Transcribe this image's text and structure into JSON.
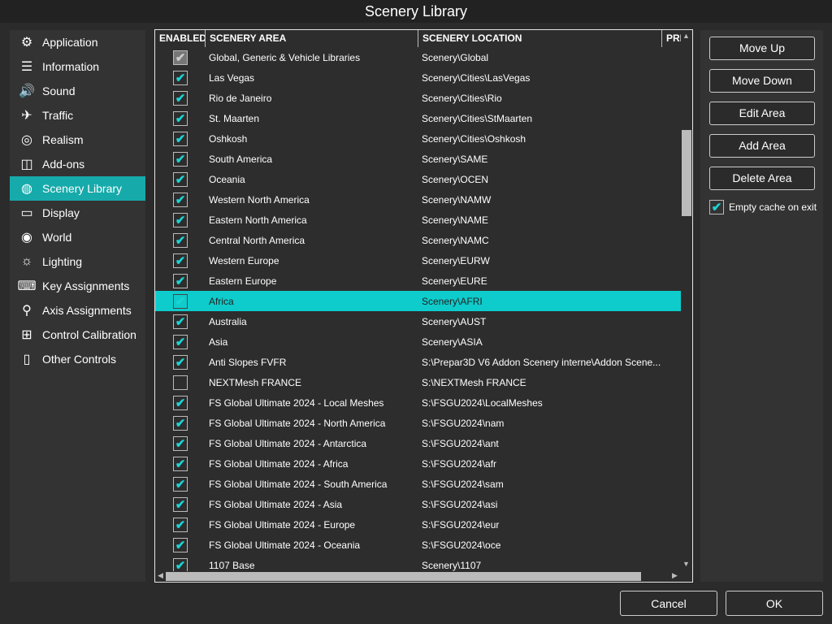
{
  "window": {
    "title": "Scenery Library"
  },
  "sidebar": {
    "items": [
      {
        "label": "Application",
        "icon": "gears-icon",
        "glyph": "⚙"
      },
      {
        "label": "Information",
        "icon": "list-icon",
        "glyph": "☰"
      },
      {
        "label": "Sound",
        "icon": "speaker-icon",
        "glyph": "🔊"
      },
      {
        "label": "Traffic",
        "icon": "airplanes-icon",
        "glyph": "✈"
      },
      {
        "label": "Realism",
        "icon": "realism-icon",
        "glyph": "◎"
      },
      {
        "label": "Add-ons",
        "icon": "addons-icon",
        "glyph": "◫"
      },
      {
        "label": "Scenery Library",
        "icon": "globe-map-icon",
        "glyph": "◍",
        "selected": true
      },
      {
        "label": "Display",
        "icon": "monitor-icon",
        "glyph": "▭"
      },
      {
        "label": "World",
        "icon": "world-icon",
        "glyph": "◉"
      },
      {
        "label": "Lighting",
        "icon": "lighting-icon",
        "glyph": "☼"
      },
      {
        "label": "Key Assignments",
        "icon": "keyboard-icon",
        "glyph": "⌨"
      },
      {
        "label": "Axis Assignments",
        "icon": "joystick-icon",
        "glyph": "⚲"
      },
      {
        "label": "Control Calibration",
        "icon": "calibration-icon",
        "glyph": "⊞"
      },
      {
        "label": "Other Controls",
        "icon": "mouse-icon",
        "glyph": "▯"
      }
    ]
  },
  "table": {
    "headers": {
      "enabled": "ENABLED",
      "area": "SCENERY AREA",
      "location": "SCENERY LOCATION",
      "priority": "PRI"
    },
    "rows": [
      {
        "enabled": true,
        "locked": true,
        "area": "Global, Generic & Vehicle Libraries",
        "location": "Scenery\\Global"
      },
      {
        "enabled": true,
        "area": "Las Vegas",
        "location": "Scenery\\Cities\\LasVegas"
      },
      {
        "enabled": true,
        "area": "Rio de Janeiro",
        "location": "Scenery\\Cities\\Rio"
      },
      {
        "enabled": true,
        "area": "St. Maarten",
        "location": "Scenery\\Cities\\StMaarten"
      },
      {
        "enabled": true,
        "area": "Oshkosh",
        "location": "Scenery\\Cities\\Oshkosh"
      },
      {
        "enabled": true,
        "area": "South America",
        "location": "Scenery\\SAME"
      },
      {
        "enabled": true,
        "area": "Oceania",
        "location": "Scenery\\OCEN"
      },
      {
        "enabled": true,
        "area": "Western North America",
        "location": "Scenery\\NAMW"
      },
      {
        "enabled": true,
        "area": "Eastern North America",
        "location": "Scenery\\NAME"
      },
      {
        "enabled": true,
        "area": "Central North America",
        "location": "Scenery\\NAMC"
      },
      {
        "enabled": true,
        "area": "Western Europe",
        "location": "Scenery\\EURW"
      },
      {
        "enabled": true,
        "area": "Eastern Europe",
        "location": "Scenery\\EURE"
      },
      {
        "enabled": true,
        "area": "Africa",
        "location": "Scenery\\AFRI",
        "selected": true
      },
      {
        "enabled": true,
        "area": "Australia",
        "location": "Scenery\\AUST"
      },
      {
        "enabled": true,
        "area": "Asia",
        "location": "Scenery\\ASIA"
      },
      {
        "enabled": true,
        "area": "Anti Slopes FVFR",
        "location": "S:\\Prepar3D V6 Addon Scenery interne\\Addon Scene..."
      },
      {
        "enabled": false,
        "area": "NEXTMesh FRANCE",
        "location": "S:\\NEXTMesh FRANCE"
      },
      {
        "enabled": true,
        "area": "FS Global Ultimate 2024 - Local Meshes",
        "location": "S:\\FSGU2024\\LocalMeshes"
      },
      {
        "enabled": true,
        "area": "FS Global Ultimate 2024 - North America",
        "location": "S:\\FSGU2024\\nam"
      },
      {
        "enabled": true,
        "area": "FS Global Ultimate 2024 - Antarctica",
        "location": "S:\\FSGU2024\\ant"
      },
      {
        "enabled": true,
        "area": "FS Global Ultimate 2024 - Africa",
        "location": "S:\\FSGU2024\\afr"
      },
      {
        "enabled": true,
        "area": "FS Global Ultimate 2024 - South America",
        "location": "S:\\FSGU2024\\sam"
      },
      {
        "enabled": true,
        "area": "FS Global Ultimate 2024 - Asia",
        "location": "S:\\FSGU2024\\asi"
      },
      {
        "enabled": true,
        "area": "FS Global Ultimate 2024 - Europe",
        "location": "S:\\FSGU2024\\eur"
      },
      {
        "enabled": true,
        "area": "FS Global Ultimate 2024 - Oceania",
        "location": "S:\\FSGU2024\\oce"
      },
      {
        "enabled": true,
        "area": "1107 Base",
        "location": "Scenery\\1107"
      }
    ]
  },
  "actions": {
    "move_up": "Move Up",
    "move_down": "Move Down",
    "edit_area": "Edit Area",
    "add_area": "Add Area",
    "delete_area": "Delete Area",
    "empty_cache_label": "Empty cache on exit",
    "empty_cache_checked": true
  },
  "footer": {
    "cancel": "Cancel",
    "ok": "OK"
  },
  "colors": {
    "accent": "#0ecccc",
    "check": "#1dd3d3"
  }
}
